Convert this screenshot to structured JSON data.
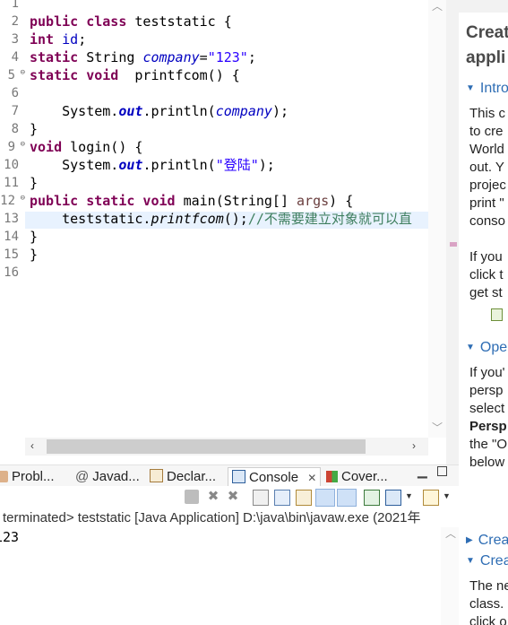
{
  "editor": {
    "line_numbers": [
      "1",
      "2",
      "3",
      "4",
      "5",
      "6",
      "7",
      "8",
      "9",
      "10",
      "11",
      "12",
      "13",
      "14",
      "15",
      "16"
    ],
    "lines": {
      "l2": {
        "kw1": "public class",
        "rest": " teststatic {"
      },
      "l3": {
        "kw": "int",
        "field": "id",
        "tail": ";"
      },
      "l4": {
        "kw": "static",
        "type": " String ",
        "field": "company",
        "eq": "=",
        "str": "\"123\"",
        "tail": ";"
      },
      "l5": {
        "kw": "static void",
        "rest": "  printfcom() {"
      },
      "l7": {
        "pre": "    System.",
        "out": "out",
        "mid": ".println(",
        "field": "company",
        "tail": ");"
      },
      "l8": {
        "text": "}"
      },
      "l9": {
        "kw": "void",
        "rest": " login() {"
      },
      "l10": {
        "pre": "    System.",
        "out": "out",
        "mid": ".println(",
        "str": "\"登陆\"",
        "tail": ");"
      },
      "l11": {
        "text": "}"
      },
      "l12": {
        "kw": "public static void",
        "mid": " main(String[] ",
        "arg": "args",
        "tail": ") {"
      },
      "l13": {
        "pre": "    teststatic.",
        "method": "printfcom",
        "mid": "();",
        "comment": "//不需要建立对象就可以直"
      },
      "l14": {
        "text": "}"
      },
      "l15": {
        "text": "}"
      }
    }
  },
  "right_panel": {
    "title_lines": [
      "Creat",
      "appli"
    ],
    "intro_header": "Intro",
    "intro_text": [
      "This c",
      "to cre",
      "World",
      "out. Y",
      "projec",
      "print \"",
      "conso"
    ],
    "para2": [
      "If you",
      "click t",
      "get st"
    ],
    "open_header": "Oper",
    "para3": [
      "If you'",
      "persp",
      "select"
    ],
    "para3_bold": "Persp",
    "para3_rest": [
      "the \"O",
      "below"
    ],
    "create1": "Crea",
    "create2": "Crea",
    "para4": [
      "The ne",
      "class.",
      "click o"
    ]
  },
  "tabs": {
    "problems": "Probl...",
    "javadoc": "Javad...",
    "declaration": "Declar...",
    "console": "Console",
    "coverage": "Cover..."
  },
  "console": {
    "header": "terminated> teststatic [Java Application] D:\\java\\bin\\javaw.exe  (2021年",
    "output": "123"
  },
  "colors": {
    "keyword": "#7f0055",
    "field": "#0000c0",
    "string": "#2a00ff",
    "comment": "#3f7f5f",
    "link": "#2e6db4",
    "current_line": "#e8f2fe"
  }
}
